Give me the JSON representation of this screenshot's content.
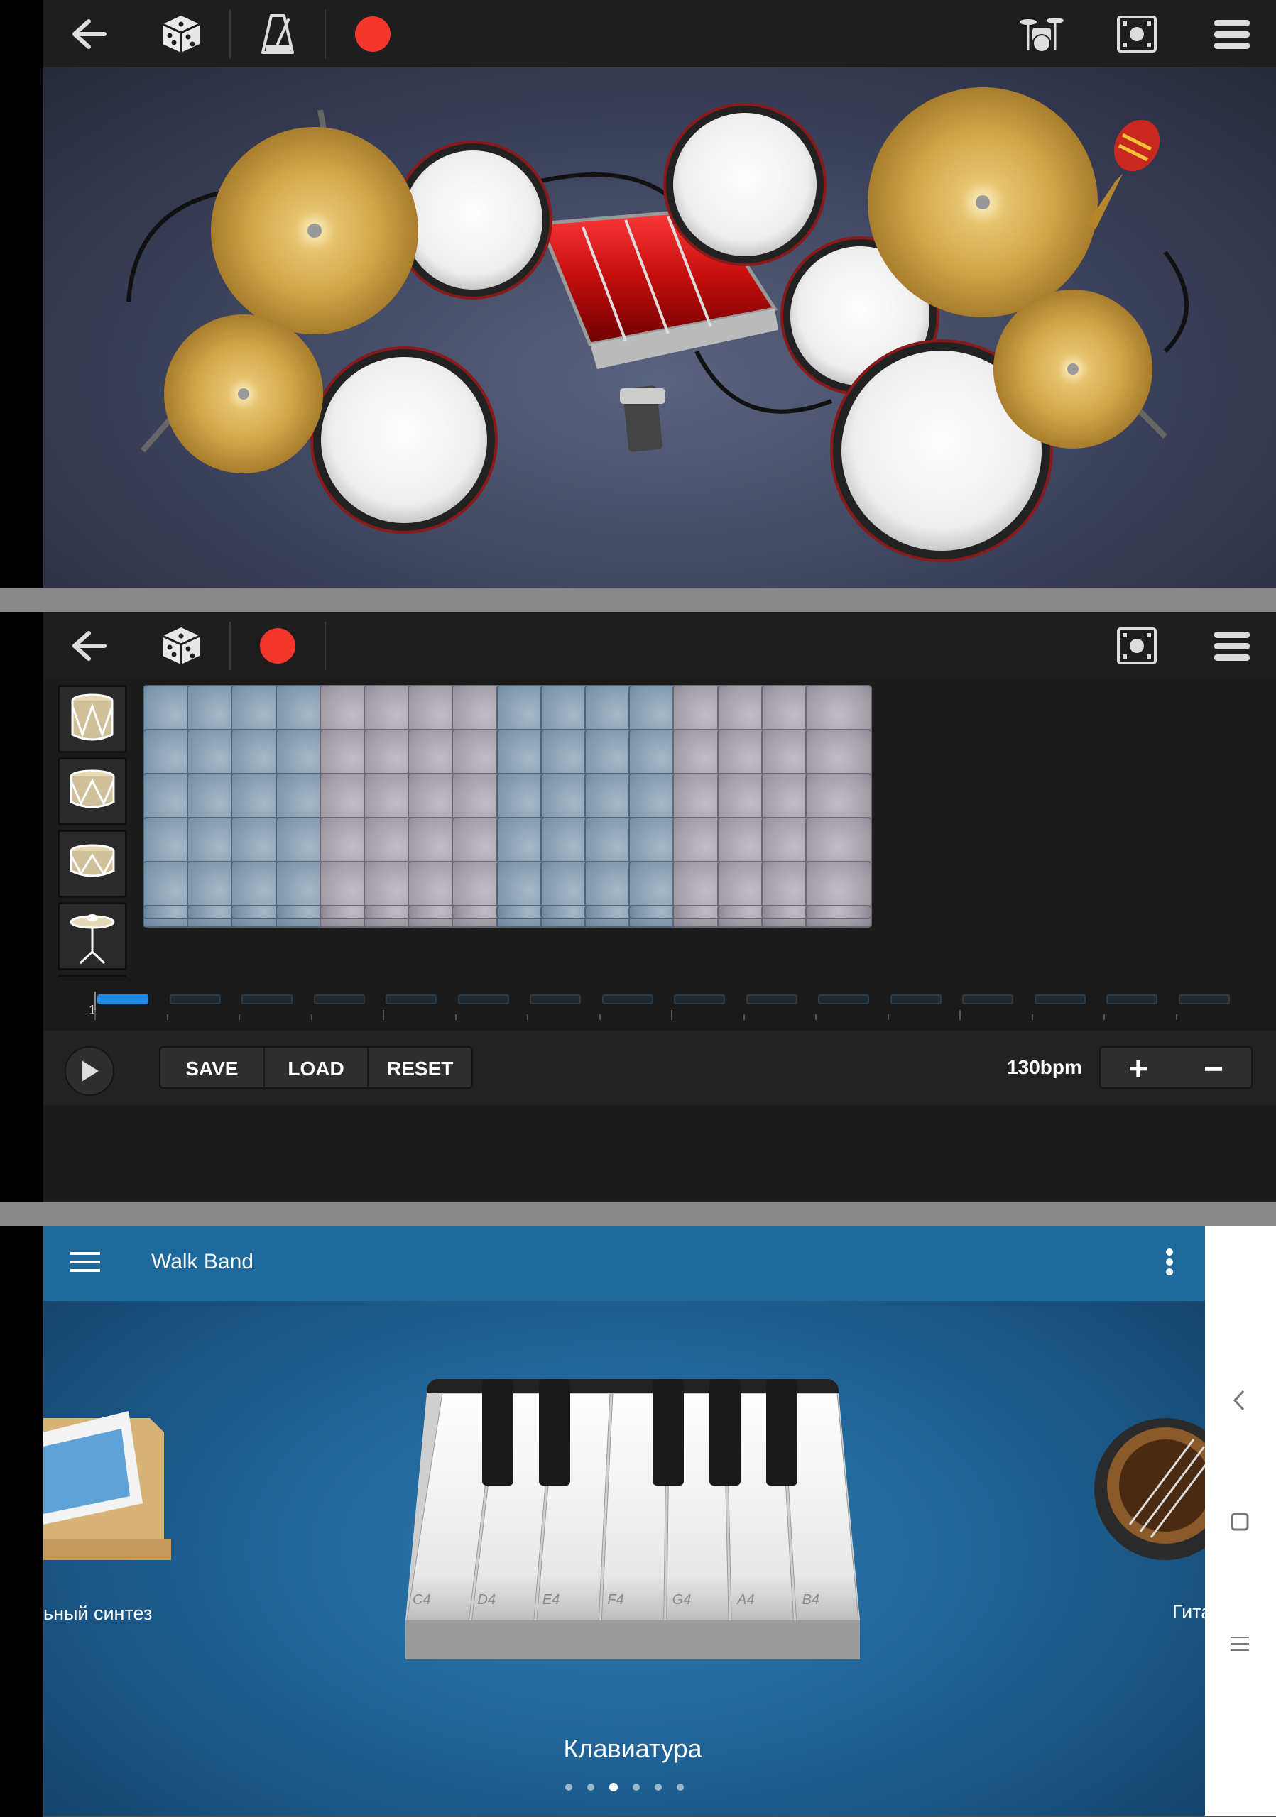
{
  "drum_kit": {
    "toolbar": {
      "icons": [
        "back-arrow-icon",
        "dice-icon",
        "metronome-icon",
        "record-icon",
        "drum-kit-icon",
        "mixer-icon",
        "menu-icon"
      ],
      "record_color": "#f5362c"
    }
  },
  "sequencer": {
    "toolbar": {
      "icons": [
        "back-arrow-icon",
        "dice-icon",
        "record-icon",
        "mixer-icon",
        "menu-icon"
      ]
    },
    "timeline": {
      "position_label": "1",
      "active_color": "#1e8ae6"
    },
    "controls": {
      "save_label": "SAVE",
      "load_label": "LOAD",
      "reset_label": "RESET",
      "tempo": "130bpm",
      "plus_label": "+",
      "minus_label": "−"
    },
    "colors": {
      "blue_cell": "#87a0b4",
      "gray_cell": "#a8a2ad"
    }
  },
  "walk_band": {
    "app_title": "Walk Band",
    "left_card_label": "ьный синтез",
    "center_card_label": "Клавиатура",
    "right_card_label": "Гита",
    "piano_keys": [
      "C4",
      "D4",
      "E4",
      "F4",
      "G4",
      "A4",
      "B4"
    ],
    "page_dots": {
      "count": 6,
      "active": 3
    },
    "system_nav": [
      "back-nav-icon",
      "home-nav-icon",
      "recents-nav-icon"
    ]
  }
}
